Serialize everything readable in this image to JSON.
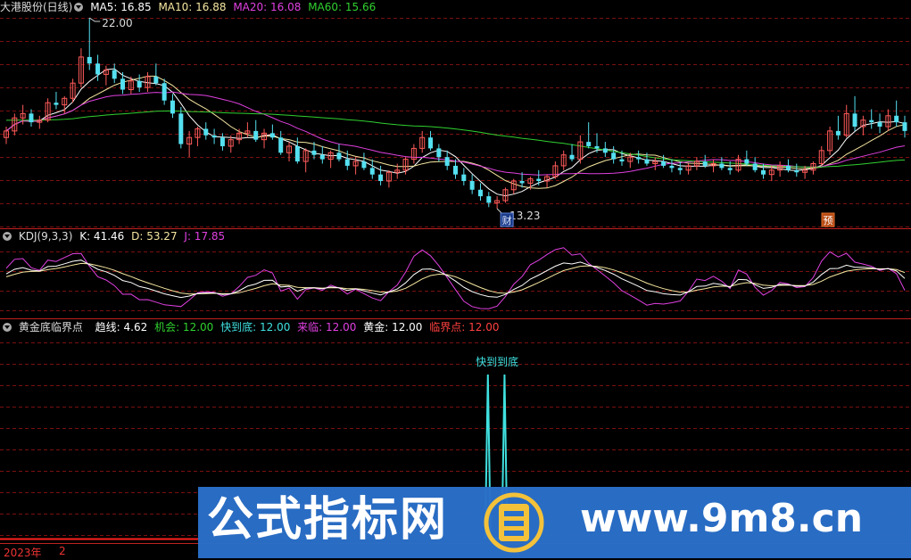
{
  "main": {
    "title": "大港股份(日线)",
    "ma": [
      {
        "label": "MA5: 16.85",
        "color": "#ffffff"
      },
      {
        "label": "MA10: 16.88",
        "color": "#f5e6a0"
      },
      {
        "label": "MA20: 16.08",
        "color": "#e040e0"
      },
      {
        "label": "MA60: 15.66",
        "color": "#30d030"
      }
    ],
    "high_label": "22.00",
    "low_label": "13.23",
    "marker_cai": "财",
    "marker_yu": "预"
  },
  "kdj": {
    "title": "KDJ(9,3,3)",
    "k": "K: 41.46",
    "d": "D: 53.27",
    "j": "J: 17.85"
  },
  "ind": {
    "title": "黄金底临界点",
    "items": [
      {
        "label": "趋线: 4.62",
        "color": "#ffffff"
      },
      {
        "label": "机会: 12.00",
        "color": "#30d030"
      },
      {
        "label": "快到底: 12.00",
        "color": "#40e0e0"
      },
      {
        "label": "来临: 12.00",
        "color": "#e040e0"
      },
      {
        "label": "黄金: 12.00",
        "color": "#ffffff"
      },
      {
        "label": "临界点: 12.00",
        "color": "#ff4040"
      }
    ],
    "signal_label": "快到到底"
  },
  "footer": {
    "year": "2023年",
    "month": "2"
  },
  "watermark": {
    "cn": "公式指标网",
    "url": "www.9m8.cn"
  },
  "colors": {
    "up": "#ff5a5a",
    "down": "#54e0f0",
    "grid": "#7a1010",
    "sep": "#c02020"
  },
  "chart_data": [
    {
      "type": "candlestick",
      "title": "大港股份(日线)",
      "annotations": [
        "22.00",
        "13.23",
        "财",
        "预"
      ],
      "candles_ohlc": [
        [
          16.5,
          17.0,
          16.2,
          16.8
        ],
        [
          16.8,
          17.6,
          16.6,
          17.4
        ],
        [
          17.4,
          18.0,
          17.1,
          17.6
        ],
        [
          17.6,
          17.8,
          17.0,
          17.2
        ],
        [
          17.2,
          17.5,
          16.9,
          17.3
        ],
        [
          17.3,
          18.3,
          17.2,
          18.1
        ],
        [
          18.1,
          18.6,
          17.8,
          18.0
        ],
        [
          18.0,
          18.4,
          17.6,
          18.3
        ],
        [
          18.3,
          19.2,
          18.1,
          19.0
        ],
        [
          19.0,
          20.6,
          18.8,
          20.2
        ],
        [
          20.2,
          22.0,
          19.6,
          19.9
        ],
        [
          19.9,
          20.3,
          19.1,
          19.4
        ],
        [
          19.4,
          19.8,
          18.9,
          19.6
        ],
        [
          19.6,
          19.9,
          19.0,
          19.2
        ],
        [
          19.2,
          19.5,
          18.5,
          18.7
        ],
        [
          18.7,
          19.3,
          18.5,
          19.1
        ],
        [
          19.1,
          19.4,
          18.6,
          18.8
        ],
        [
          18.8,
          19.5,
          18.6,
          19.3
        ],
        [
          19.3,
          19.9,
          18.9,
          19.0
        ],
        [
          19.0,
          19.2,
          18.0,
          18.2
        ],
        [
          18.2,
          18.5,
          17.4,
          17.6
        ],
        [
          17.6,
          17.9,
          16.0,
          16.2
        ],
        [
          16.2,
          16.8,
          15.6,
          16.5
        ],
        [
          16.5,
          17.0,
          16.1,
          16.9
        ],
        [
          16.9,
          17.2,
          16.4,
          16.6
        ],
        [
          16.6,
          16.9,
          16.2,
          16.5
        ],
        [
          16.5,
          16.7,
          15.9,
          16.1
        ],
        [
          16.1,
          16.6,
          15.8,
          16.4
        ],
        [
          16.4,
          16.9,
          16.2,
          16.7
        ],
        [
          16.7,
          17.2,
          16.5,
          16.8
        ],
        [
          16.8,
          17.3,
          16.3,
          16.4
        ],
        [
          16.4,
          16.9,
          16.0,
          16.7
        ],
        [
          16.7,
          17.1,
          16.4,
          16.5
        ],
        [
          16.5,
          16.8,
          15.7,
          15.8
        ],
        [
          15.8,
          16.3,
          15.4,
          16.1
        ],
        [
          16.1,
          16.5,
          15.3,
          15.4
        ],
        [
          15.4,
          16.0,
          14.9,
          15.9
        ],
        [
          15.9,
          16.3,
          15.5,
          15.7
        ],
        [
          15.7,
          16.1,
          15.3,
          15.5
        ],
        [
          15.5,
          15.9,
          15.1,
          15.8
        ],
        [
          15.8,
          16.2,
          15.4,
          15.5
        ],
        [
          15.5,
          15.9,
          15.0,
          15.2
        ],
        [
          15.2,
          15.6,
          14.8,
          15.4
        ],
        [
          15.4,
          15.8,
          15.0,
          15.1
        ],
        [
          15.1,
          15.5,
          14.6,
          14.8
        ],
        [
          14.8,
          15.2,
          14.3,
          14.5
        ],
        [
          14.5,
          15.0,
          14.2,
          14.9
        ],
        [
          14.9,
          15.3,
          14.6,
          15.0
        ],
        [
          15.0,
          15.6,
          14.8,
          15.5
        ],
        [
          15.5,
          16.2,
          15.3,
          16.0
        ],
        [
          16.0,
          16.8,
          15.8,
          16.5
        ],
        [
          16.5,
          16.8,
          15.9,
          16.0
        ],
        [
          16.0,
          16.2,
          15.4,
          15.6
        ],
        [
          15.6,
          15.9,
          15.0,
          15.2
        ],
        [
          15.2,
          15.5,
          14.6,
          14.8
        ],
        [
          14.8,
          15.1,
          14.3,
          14.5
        ],
        [
          14.5,
          14.8,
          13.9,
          14.1
        ],
        [
          14.1,
          14.4,
          13.6,
          13.8
        ],
        [
          13.8,
          14.0,
          13.3,
          13.5
        ],
        [
          13.5,
          13.8,
          13.23,
          13.6
        ],
        [
          13.6,
          14.2,
          13.5,
          14.1
        ],
        [
          14.1,
          14.6,
          13.9,
          14.5
        ],
        [
          14.5,
          14.9,
          14.2,
          14.4
        ],
        [
          14.4,
          14.7,
          14.1,
          14.6
        ],
        [
          14.6,
          15.0,
          14.3,
          14.5
        ],
        [
          14.5,
          14.8,
          14.2,
          14.7
        ],
        [
          14.7,
          15.4,
          14.6,
          15.2
        ],
        [
          15.2,
          15.9,
          15.0,
          15.7
        ],
        [
          15.7,
          16.2,
          15.4,
          15.5
        ],
        [
          15.5,
          16.6,
          15.3,
          16.3
        ],
        [
          16.3,
          17.2,
          16.0,
          16.1
        ],
        [
          16.1,
          16.7,
          15.8,
          16.0
        ],
        [
          16.0,
          16.3,
          15.6,
          15.8
        ],
        [
          15.8,
          16.1,
          15.3,
          15.5
        ],
        [
          15.5,
          15.9,
          15.2,
          15.4
        ],
        [
          15.4,
          15.8,
          15.1,
          15.6
        ],
        [
          15.6,
          15.9,
          15.3,
          15.5
        ],
        [
          15.5,
          15.8,
          15.2,
          15.3
        ],
        [
          15.3,
          15.6,
          15.0,
          15.4
        ],
        [
          15.4,
          15.7,
          15.1,
          15.2
        ],
        [
          15.2,
          15.5,
          14.9,
          15.1
        ],
        [
          15.1,
          15.4,
          14.8,
          15.0
        ],
        [
          15.0,
          15.3,
          14.8,
          15.2
        ],
        [
          15.2,
          15.6,
          15.0,
          15.4
        ],
        [
          15.4,
          15.7,
          15.1,
          15.2
        ],
        [
          15.2,
          15.5,
          14.9,
          15.3
        ],
        [
          15.3,
          15.6,
          15.0,
          15.1
        ],
        [
          15.1,
          15.4,
          14.8,
          15.0
        ],
        [
          15.0,
          15.7,
          14.9,
          15.5
        ],
        [
          15.5,
          15.9,
          15.2,
          15.3
        ],
        [
          15.3,
          15.6,
          14.9,
          15.0
        ],
        [
          15.0,
          15.3,
          14.6,
          14.8
        ],
        [
          14.8,
          15.2,
          14.5,
          15.0
        ],
        [
          15.0,
          15.4,
          14.7,
          15.2
        ],
        [
          15.2,
          15.5,
          14.9,
          15.0
        ],
        [
          15.0,
          15.3,
          14.7,
          14.9
        ],
        [
          14.9,
          15.2,
          14.6,
          15.0
        ],
        [
          15.0,
          15.4,
          14.8,
          15.3
        ],
        [
          15.3,
          16.1,
          15.2,
          15.9
        ],
        [
          15.9,
          17.0,
          15.7,
          16.8
        ],
        [
          16.8,
          17.5,
          16.4,
          16.6
        ],
        [
          16.6,
          18.0,
          16.5,
          17.6
        ],
        [
          17.6,
          18.4,
          16.8,
          17.0
        ],
        [
          17.0,
          17.5,
          16.6,
          17.3
        ],
        [
          17.3,
          17.8,
          16.9,
          17.2
        ],
        [
          17.2,
          17.6,
          16.7,
          17.0
        ],
        [
          17.0,
          17.8,
          16.8,
          17.5
        ],
        [
          17.5,
          18.2,
          17.0,
          17.2
        ],
        [
          17.2,
          17.5,
          16.5,
          16.8
        ]
      ]
    },
    {
      "type": "line",
      "title": "KDJ(9,3,3)",
      "series": [
        {
          "name": "K"
        },
        {
          "name": "D"
        },
        {
          "name": "J"
        }
      ]
    },
    {
      "type": "line",
      "title": "黄金底临界点",
      "annotations": [
        "快到到底"
      ]
    }
  ]
}
